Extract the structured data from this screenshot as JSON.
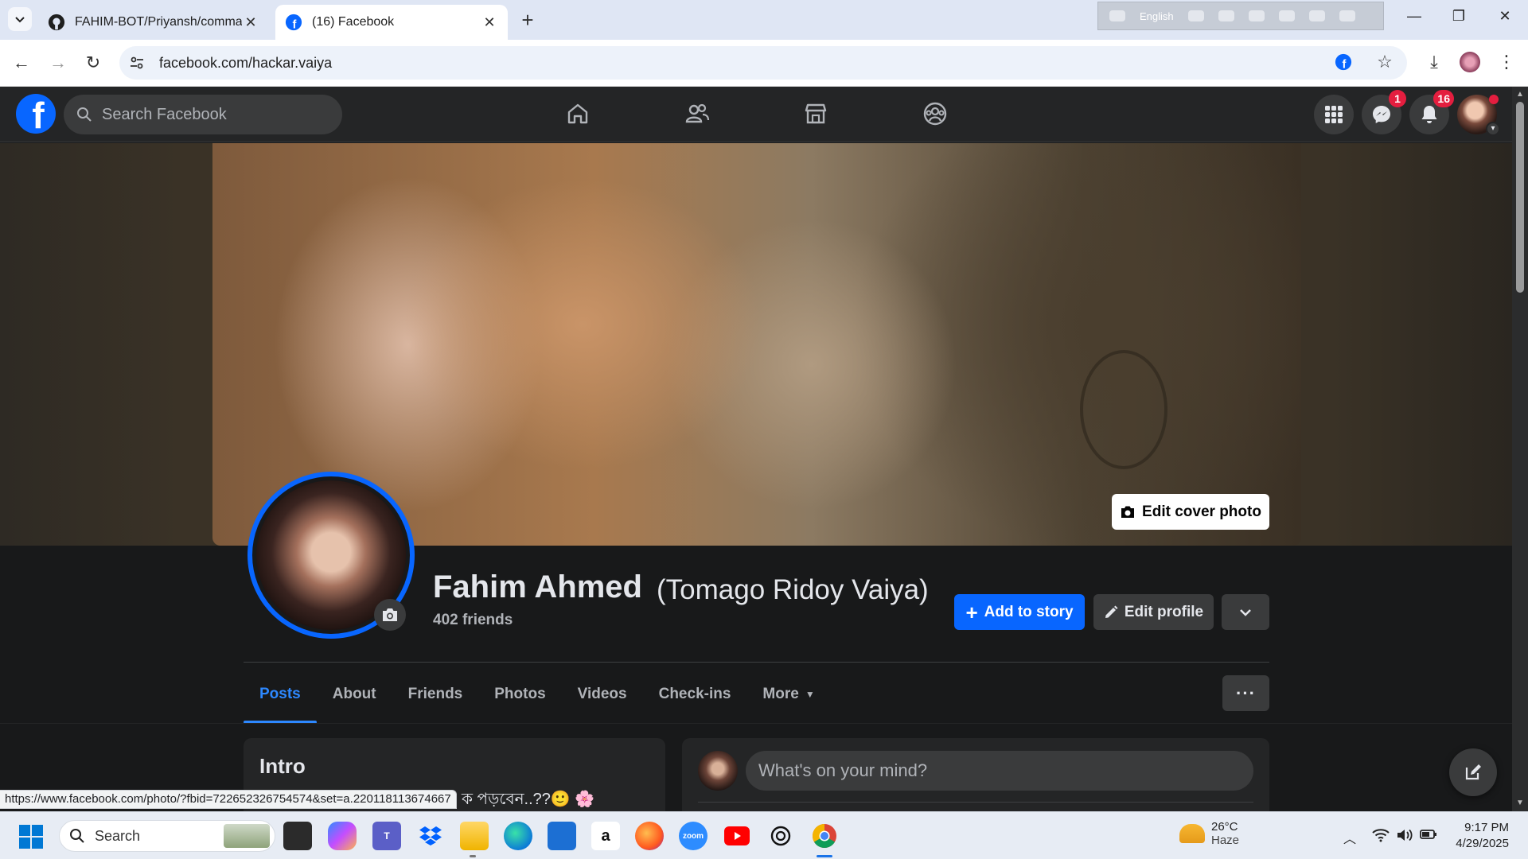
{
  "browser": {
    "tabs": [
      {
        "title": "FAHIM-BOT/Priyansh/command",
        "active": false
      },
      {
        "title": "(16) Facebook",
        "active": true
      }
    ],
    "ime_language": "English",
    "url": "facebook.com/hackar.vaiya"
  },
  "fb_header": {
    "search_placeholder": "Search Facebook",
    "messenger_badge": "1",
    "notifications_badge": "16",
    "brand_color": "#0866ff"
  },
  "profile": {
    "edit_cover_label": "Edit cover photo",
    "name": "Fahim Ahmed",
    "alternate_name": "(Tomago Ridoy Vaiya)",
    "friends": "402 friends",
    "add_story_label": "Add to story",
    "edit_profile_label": "Edit profile"
  },
  "profile_tabs": [
    "Posts",
    "About",
    "Friends",
    "Photos",
    "Videos",
    "Check-ins",
    "More"
  ],
  "intro": {
    "title": "Intro",
    "bio_fragment": "ক পড়বেন..??🙂 🌸"
  },
  "composer": {
    "placeholder": "What's on your mind?"
  },
  "status_bar_url": "https://www.facebook.com/photo/?fbid=722652326754574&set=a.220118113674667",
  "taskbar": {
    "search_label": "Search",
    "weather_temp": "26°C",
    "weather_desc": "Haze",
    "time": "9:17 PM",
    "date": "4/29/2025"
  }
}
